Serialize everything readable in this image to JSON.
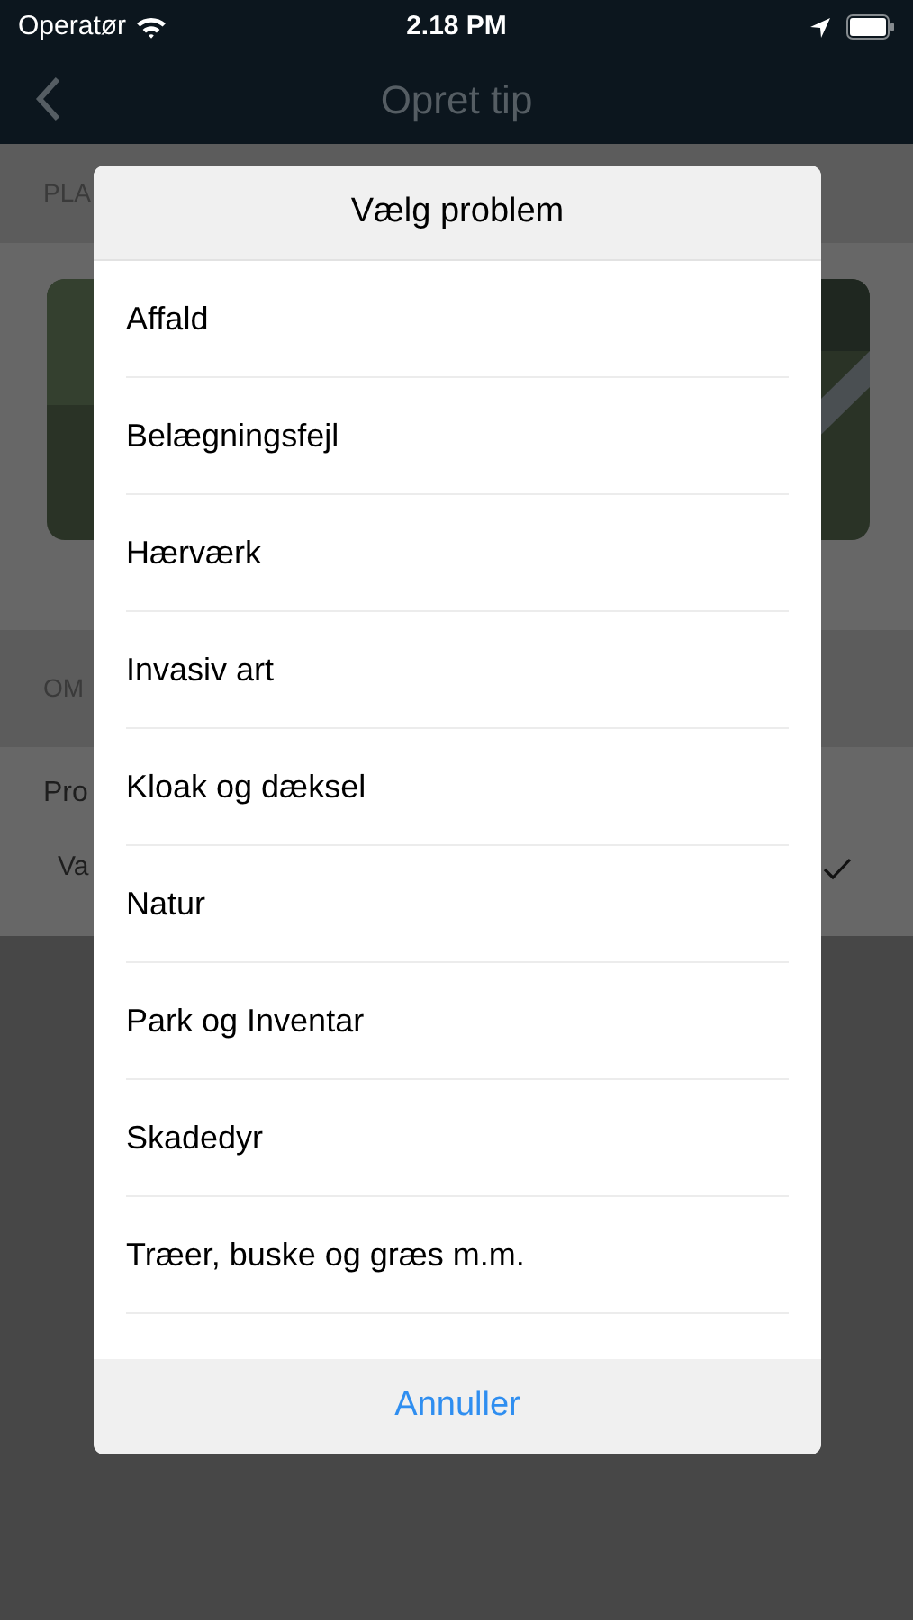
{
  "status_bar": {
    "carrier": "Operatør",
    "time": "2.18 PM"
  },
  "nav_bar": {
    "title": "Opret tip"
  },
  "background": {
    "section_1_header": "PLA",
    "section_2_header": "OM",
    "field_label": "Pro",
    "field_value": "Va",
    "field_checked": true
  },
  "dialog": {
    "title": "Vælg problem",
    "options": [
      {
        "label": "Affald"
      },
      {
        "label": "Belægningsfejl"
      },
      {
        "label": "Hærværk"
      },
      {
        "label": "Invasiv art"
      },
      {
        "label": "Kloak og dæksel"
      },
      {
        "label": "Natur"
      },
      {
        "label": "Park og Inventar"
      },
      {
        "label": "Skadedyr"
      },
      {
        "label": "Træer, buske og græs m.m."
      }
    ],
    "cancel": "Annuller"
  }
}
